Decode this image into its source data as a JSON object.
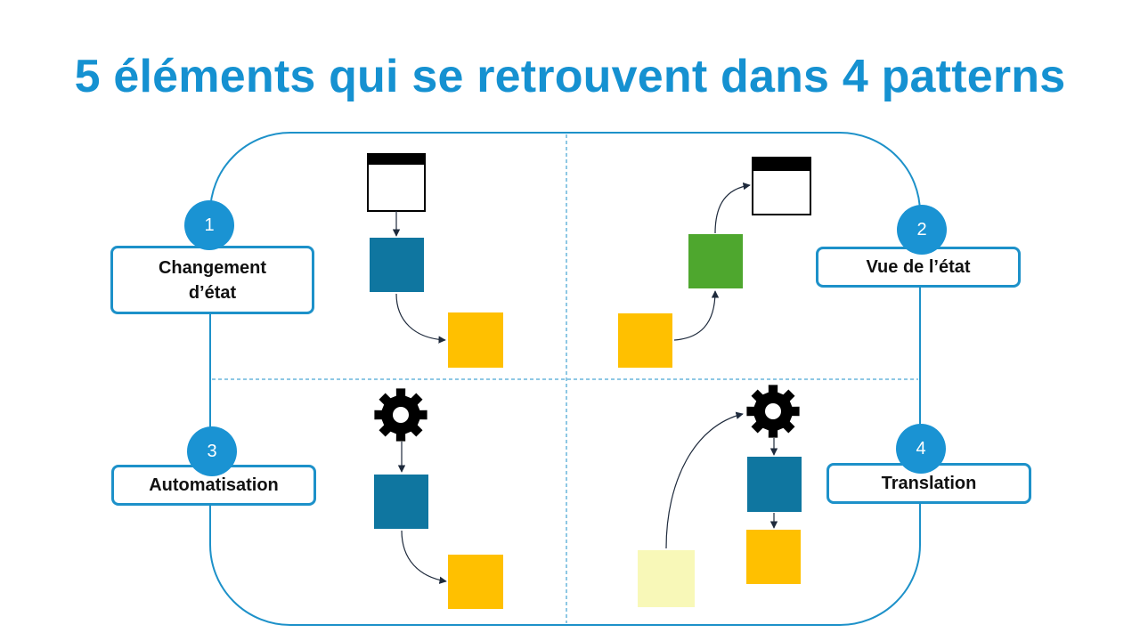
{
  "title": "5 éléments qui se retrouvent dans 4 patterns",
  "colors": {
    "title": "#1591d1",
    "frame": "#1d91c9",
    "badge": "#1a93d3",
    "command": "#0f76a0",
    "event": "#ffc000",
    "read_model": "#4ea72e",
    "external_event": "#f8f8b8",
    "view_header": "#000000",
    "gear": "#000000",
    "arrow": "#1e2a3c"
  },
  "patterns": [
    {
      "number": "1",
      "label": "Changement d’état"
    },
    {
      "number": "2",
      "label": "Vue de l’état"
    },
    {
      "number": "3",
      "label": "Automatisation"
    },
    {
      "number": "4",
      "label": "Translation"
    }
  ],
  "icons": {
    "view": "ui-window-icon",
    "processor": "gear-icon"
  }
}
